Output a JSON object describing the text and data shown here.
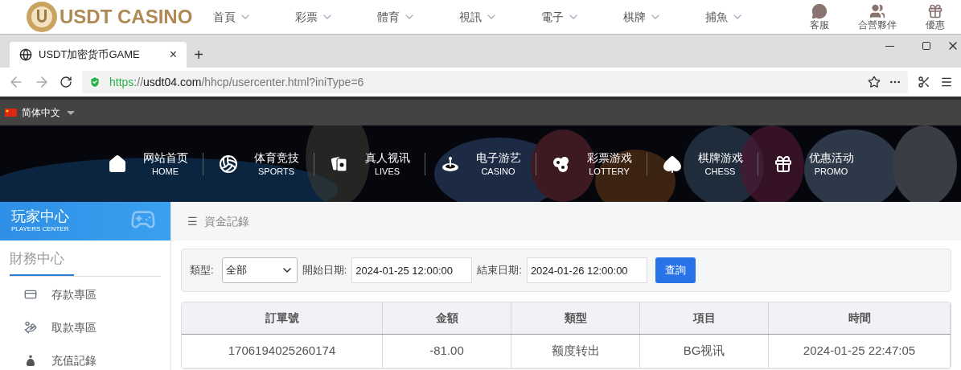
{
  "site_header": {
    "logo": "USDT CASINO",
    "nav": [
      {
        "label": "首頁"
      },
      {
        "label": "彩票"
      },
      {
        "label": "體育"
      },
      {
        "label": "視訊"
      },
      {
        "label": "電子"
      },
      {
        "label": "棋牌"
      },
      {
        "label": "捕魚"
      }
    ],
    "links": [
      {
        "kind": "chat",
        "label": "客服"
      },
      {
        "kind": "partners",
        "label": "合營夥伴"
      },
      {
        "kind": "gift",
        "label": "優惠"
      }
    ]
  },
  "browser": {
    "tab": {
      "title": "USDT加密货币GAME",
      "close": "×"
    },
    "new_tab": "+",
    "url": {
      "scheme": "https",
      "separator": "://",
      "host": "usdt04.com",
      "path": "/hhcp/usercenter.html?iniType=6"
    }
  },
  "top_bar": {
    "language": "简体中文"
  },
  "main_nav": [
    {
      "kind": "home",
      "label": "网站首页",
      "sub": "HOME"
    },
    {
      "kind": "sports",
      "label": "体育竞技",
      "sub": "SPORTS"
    },
    {
      "kind": "live",
      "label": "真人视讯",
      "sub": "LIVES"
    },
    {
      "kind": "casino",
      "label": "电子游艺",
      "sub": "CASINO"
    },
    {
      "kind": "lottery",
      "label": "彩票游戏",
      "sub": "LOTTERY"
    },
    {
      "kind": "chess",
      "label": "棋牌游戏",
      "sub": "CHESS"
    },
    {
      "kind": "promo",
      "label": "优惠活动",
      "sub": "PROMO"
    }
  ],
  "sidebar": {
    "title": "玩家中心",
    "subtitle": "PLAYERS CENTER",
    "section": "財務中心",
    "items": [
      {
        "kind": "deposit",
        "label": "存款專區"
      },
      {
        "kind": "withdraw",
        "label": "取款專區"
      },
      {
        "kind": "records",
        "label": "充值記錄"
      }
    ]
  },
  "breadcrumb": {
    "icon": "☰",
    "title": "資金記錄"
  },
  "filters": {
    "type_label": "類型:",
    "type_value": "全部",
    "start_label": "開始日期:",
    "start_value": "2024-01-25 12:00:00",
    "end_label": "結束日期:",
    "end_value": "2024-01-26 12:00:00",
    "search_button": "查詢"
  },
  "table": {
    "columns": [
      "訂單號",
      "金額",
      "類型",
      "項目",
      "時間"
    ],
    "rows": [
      [
        "1706194025260174",
        "-81.00",
        "额度转出",
        "BG视讯",
        "2024-01-25 22:47:05"
      ]
    ]
  }
}
